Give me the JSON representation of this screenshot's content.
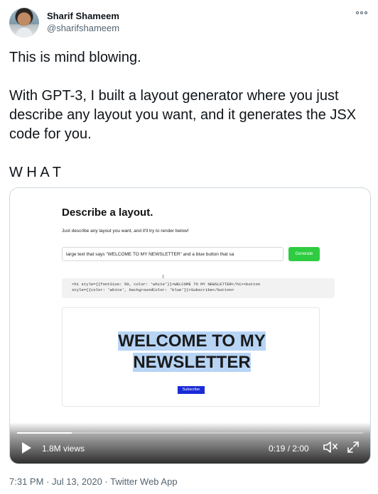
{
  "author": {
    "name": "Sharif Shameem",
    "handle": "@sharifshameem"
  },
  "tweet": {
    "text": "This is mind blowing.\n\nWith GPT-3, I built a layout generator where you just describe any layout you want, and it generates the JSX code for you.\n\nW H A T"
  },
  "video": {
    "frame": {
      "title": "Describe a layout.",
      "subtitle": "Just describe any layout you want, and it'll try to render below!",
      "input_value": "large text that says \"WELCOME TO MY NEWSLETTER\" and a blue button that sa",
      "generate_label": "Generate",
      "code_line1": "<h1 style={{fontSize: 50, color: 'white'}}>WELCOME TO MY NEWSLETTER</h1><button",
      "code_line2": "style={{color: 'white', backgroundColor: 'blue'}}>Subscribe</button>",
      "preview_heading_line1": "WELCOME TO MY",
      "preview_heading_line2": "NEWSLETTER",
      "preview_button_label": "Subscribe"
    },
    "views": "1.8M views",
    "time": "0:19 / 2:00",
    "progress_fraction": 0.158,
    "icons": [
      "play-icon",
      "volume-icon",
      "fullscreen-icon"
    ]
  },
  "footer": {
    "timestamp": "7:31 PM · Jul 13, 2020",
    "separator": " · ",
    "source": "Twitter Web App"
  },
  "colors": {
    "text": "#0f1419",
    "muted": "#536471",
    "border": "#cfd9de",
    "generate_button": "#2ecc40",
    "subscribe_button": "#1a2bd6",
    "highlight": "#b7d4f5"
  }
}
